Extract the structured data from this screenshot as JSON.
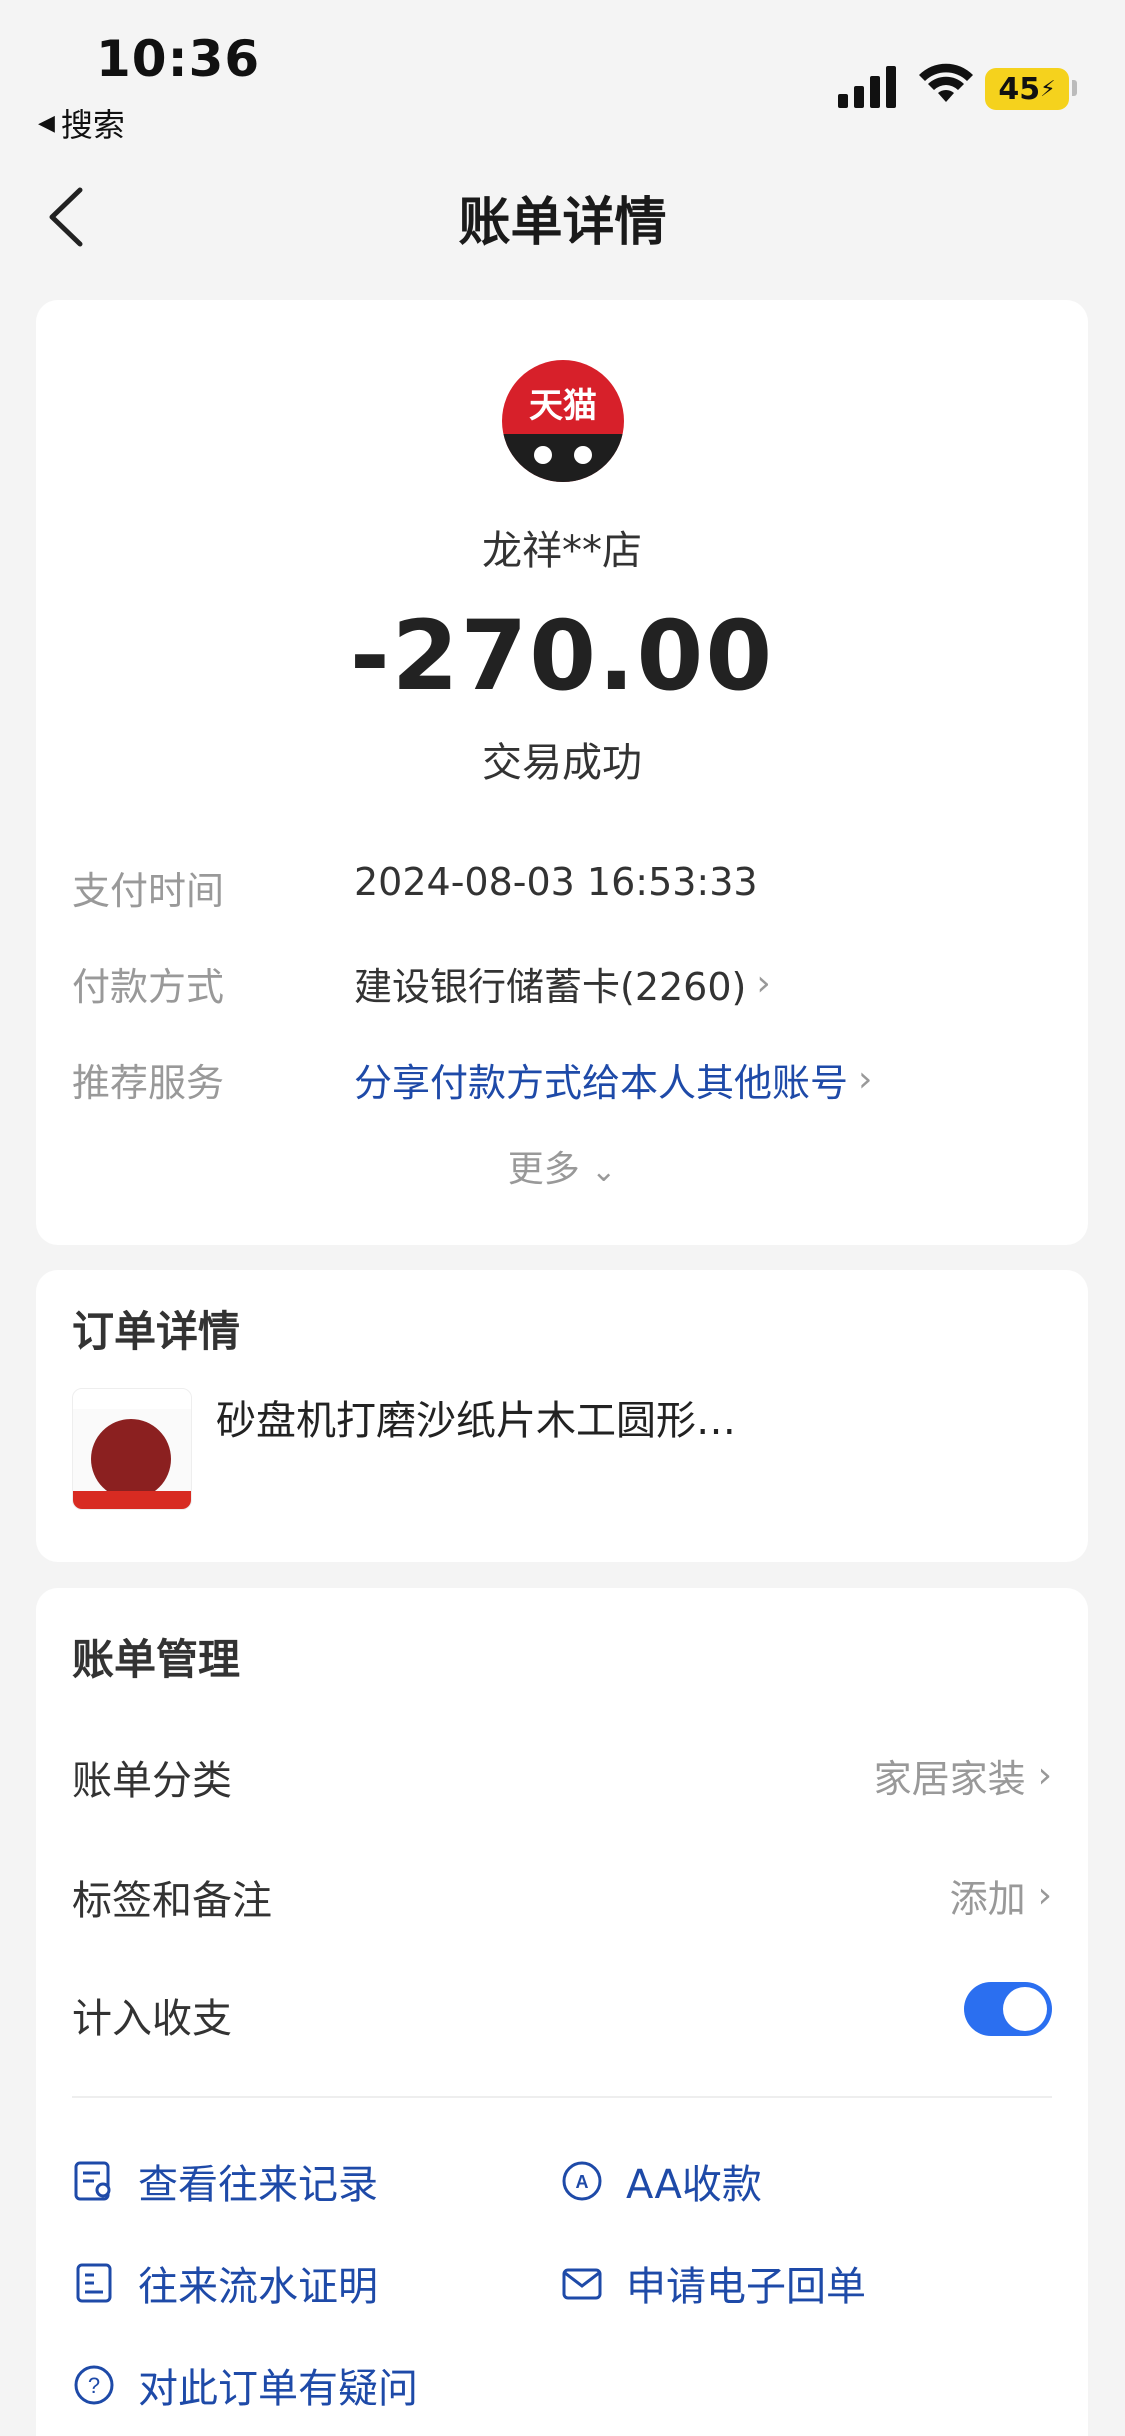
{
  "status_bar": {
    "time": "10:36",
    "back_app": "搜索",
    "battery": "45"
  },
  "nav": {
    "title": "账单详情"
  },
  "bill": {
    "merchant": "龙祥**店",
    "logo_text": "天猫",
    "amount": "-270.00",
    "status": "交易成功",
    "rows": [
      {
        "label": "支付时间",
        "value": "2024-08-03 16:53:33"
      },
      {
        "label": "付款方式",
        "value": "建设银行储蓄卡(2260)"
      },
      {
        "label": "推荐服务",
        "value": "分享付款方式给本人其他账号"
      }
    ],
    "more": "更多"
  },
  "order": {
    "title": "订单详情",
    "product_name": "砂盘机打磨沙纸片木工圆形…"
  },
  "manage": {
    "title": "账单管理",
    "category_label": "账单分类",
    "category_value": "家居家装",
    "tag_label": "标签和备注",
    "tag_value": "添加",
    "include_label": "计入收支",
    "include_on": true,
    "actions": {
      "history": "查看往来记录",
      "aa": "AA收款",
      "proof": "往来流水证明",
      "receipt": "申请电子回单",
      "question": "对此订单有疑问"
    }
  },
  "colors": {
    "accent": "#2b6ff0",
    "link": "#1e4aa8",
    "brand_red": "#d7202a"
  }
}
